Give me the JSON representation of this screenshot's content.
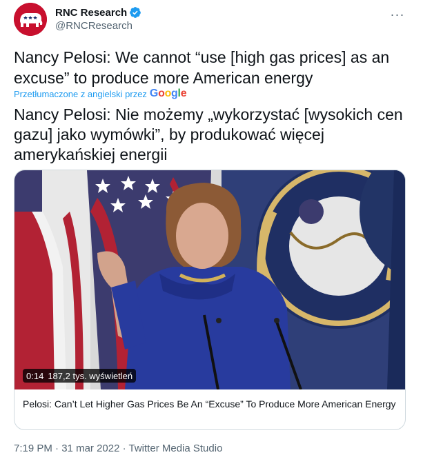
{
  "author": {
    "display_name": "RNC Research",
    "handle": "@RNCResearch",
    "verified_icon": "verified-badge-icon",
    "more_label": "···"
  },
  "tweet": {
    "text": "Nancy Pelosi: We cannot “use [high gas prices] as an excuse” to produce more American energy",
    "translated_by": "Przetłumaczone z angielski przez",
    "translator_logo": {
      "G": "G",
      "o1": "o",
      "o2": "o",
      "g": "g",
      "l": "l",
      "e": "e"
    },
    "translated_text": "Nancy Pelosi: Nie możemy „wykorzystać [wysokich cen gazu] jako wymówki”, by produkować więcej amerykańskiej energii"
  },
  "media": {
    "duration": "0:14",
    "views": "187,2 tys. wyświetleń",
    "card_title": "Pelosi: Can’t Let Higher Gas Prices Be An “Excuse” To Produce More American Energy"
  },
  "meta": {
    "time": "7:19 PM",
    "dot1": " · ",
    "date": "31 mar 2022",
    "dot2": " · ",
    "source": "Twitter Media Studio"
  }
}
